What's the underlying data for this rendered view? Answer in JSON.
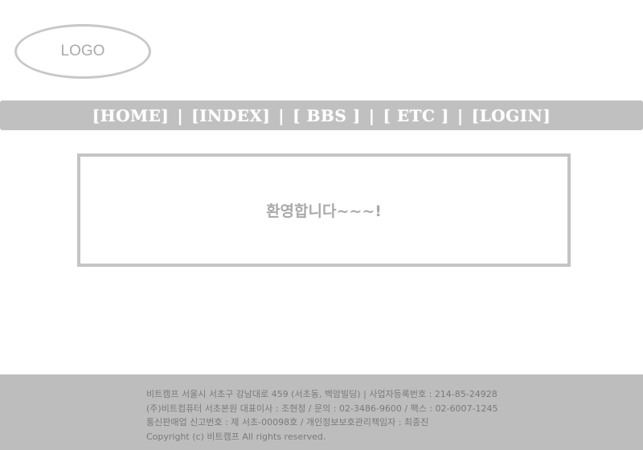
{
  "logo": {
    "text": "LOGO"
  },
  "nav": {
    "items": [
      "[HOME]",
      "[INDEX]",
      "[ BBS ]",
      "[ ETC ]",
      "[LOGIN]"
    ],
    "separator": "|"
  },
  "main": {
    "welcome": "환영합니다~~~!"
  },
  "footer": {
    "lines": [
      "비트캠프 서울시 서초구 강남대로 459 (서초동, 백암빌딩) |  사업자등록번호 : 214-85-24928",
      "(주)비트컴퓨터 서초본원 대표이사 : 조현정 / 문의 : 02-3486-9600 / 팩스 : 02-6007-1245",
      "통신판매업 신고번호 : 제 서초-00098호 / 개인정보보호관리책임자 : 최종진",
      "Copyright (c) 비트캠프 All rights reserved."
    ]
  },
  "colors": {
    "nav_bg": "#c0c0c0",
    "footer_bg": "#bdbdbd",
    "border": "#c4c4c4",
    "text_muted": "#a9a9a9"
  }
}
